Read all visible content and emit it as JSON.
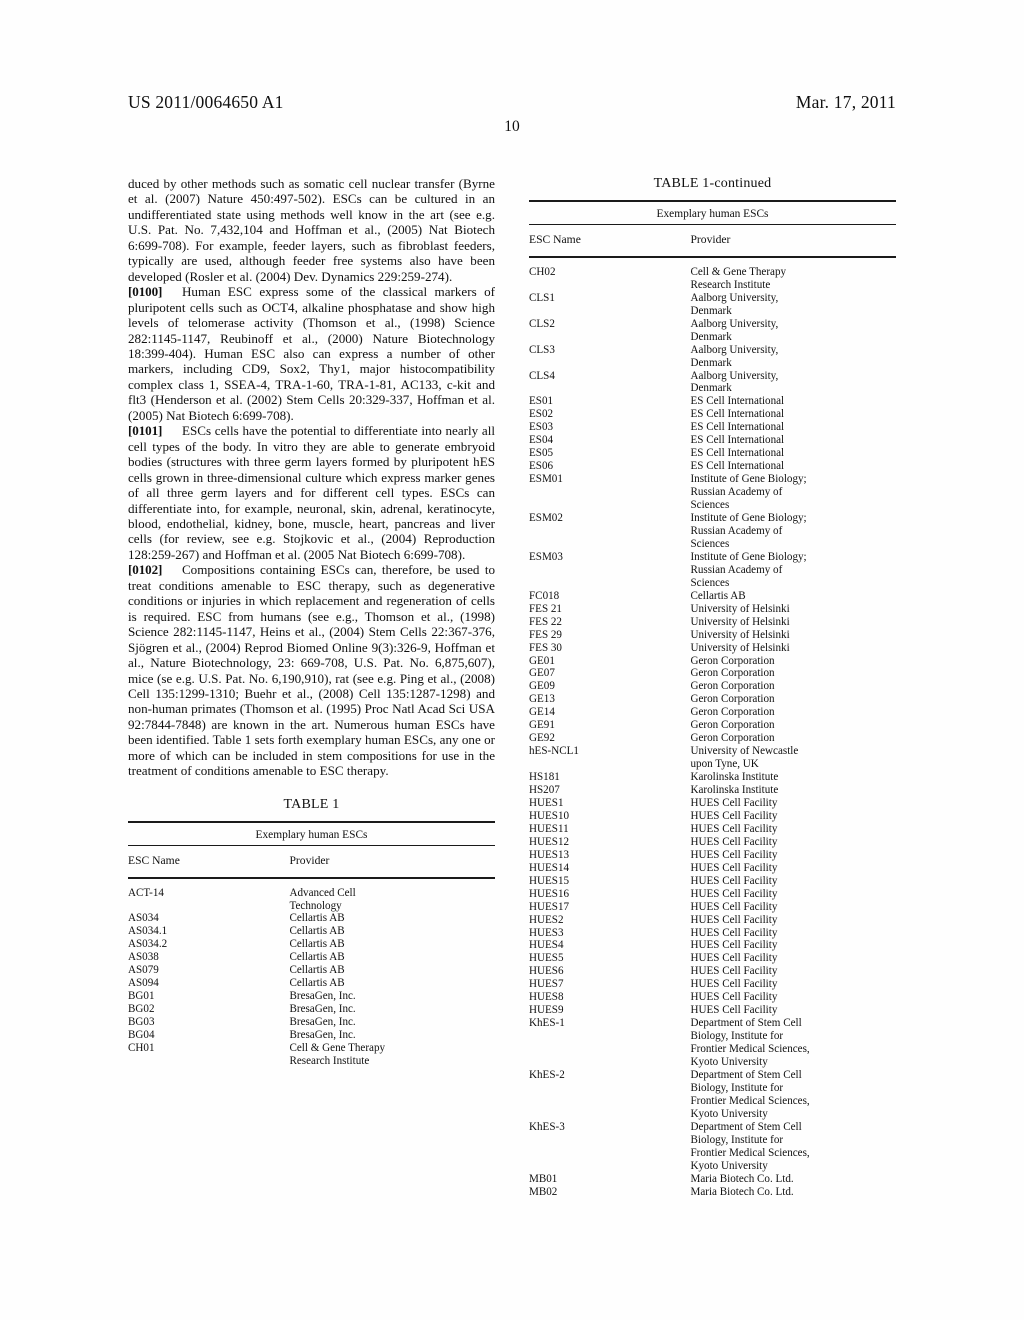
{
  "header": {
    "publication_number": "US 2011/0064650 A1",
    "date": "Mar. 17, 2011",
    "page_number": "10"
  },
  "left_column": {
    "paragraphs": [
      {
        "id": "",
        "text": "duced by other methods such as somatic cell nuclear transfer (Byrne et al. (2007) Nature 450:497-502). ESCs can be cultured in an undifferentiated state using methods well know in the art (see e.g. U.S. Pat. No. 7,432,104 and Hoffman et al., (2005) Nat Biotech 6:699-708). For example, feeder layers, such as fibroblast feeders, typically are used, although feeder free systems also have been developed (Rosler et al. (2004) Dev. Dynamics 229:259-274)."
      },
      {
        "id": "[0100]",
        "text": "Human ESC express some of the classical markers of pluripotent cells such as OCT4, alkaline phosphatase and show high levels of telomerase activity (Thomson et al., (1998) Science 282:1145-1147, Reubinoff et al., (2000) Nature Biotechnology 18:399-404). Human ESC also can express a number of other markers, including CD9, Sox2, Thy1, major histocompatibility complex class 1, SSEA-4, TRA-1-60, TRA-1-81, AC133, c-kit and flt3 (Henderson et al. (2002) Stem Cells 20:329-337, Hoffman et al. (2005) Nat Biotech 6:699-708)."
      },
      {
        "id": "[0101]",
        "text": "ESCs cells have the potential to differentiate into nearly all cell types of the body. In vitro they are able to generate embryoid bodies (structures with three germ layers formed by pluripotent hES cells grown in three-dimensional culture which express marker genes of all three germ layers and for different cell types. ESCs can differentiate into, for example, neuronal, skin, adrenal, keratinocyte, blood, endothelial, kidney, bone, muscle, heart, pancreas and liver cells (for review, see e.g. Stojkovic et al., (2004) Reproduction 128:259-267) and Hoffman et al. (2005 Nat Biotech 6:699-708)."
      },
      {
        "id": "[0102]",
        "text": "Compositions containing ESCs can, therefore, be used to treat conditions amenable to ESC therapy, such as degenerative conditions or injuries in which replacement and regeneration of cells is required. ESC from humans (see e.g., Thomson et al., (1998) Science 282:1145-1147, Heins et al., (2004) Stem Cells 22:367-376, Sjögren et al., (2004) Reprod Biomed Online 9(3):326-9, Hoffman et al., Nature Biotechnology, 23: 669-708, U.S. Pat. No. 6,875,607), mice (se e.g. U.S. Pat. No. 6,190,910), rat (see e.g. Ping et al., (2008) Cell 135:1299-1310; Buehr et al., (2008) Cell 135:1287-1298) and non-human primates (Thomson et al. (1995) Proc Natl Acad Sci USA 92:7844-7848) are known in the art. Numerous human ESCs have been identified. Table 1 sets forth exemplary human ESCs, any one or more of which can be included in stem compositions for use in the treatment of conditions amenable to ESC therapy."
      }
    ],
    "table": {
      "caption": "TABLE 1",
      "span_header": "Exemplary human ESCs",
      "columns": [
        "ESC Name",
        "Provider"
      ],
      "rows": [
        [
          "ACT-14",
          "Advanced Cell\nTechnology"
        ],
        [
          "AS034",
          "Cellartis AB"
        ],
        [
          "AS034.1",
          "Cellartis AB"
        ],
        [
          "AS034.2",
          "Cellartis AB"
        ],
        [
          "AS038",
          "Cellartis AB"
        ],
        [
          "AS079",
          "Cellartis AB"
        ],
        [
          "AS094",
          "Cellartis AB"
        ],
        [
          "BG01",
          "BresaGen, Inc."
        ],
        [
          "BG02",
          "BresaGen, Inc."
        ],
        [
          "BG03",
          "BresaGen, Inc."
        ],
        [
          "BG04",
          "BresaGen, Inc."
        ],
        [
          "CH01",
          "Cell & Gene Therapy\nResearch Institute"
        ]
      ]
    }
  },
  "right_column": {
    "table": {
      "caption": "TABLE 1-continued",
      "span_header": "Exemplary human ESCs",
      "columns": [
        "ESC Name",
        "Provider"
      ],
      "rows": [
        [
          "CH02",
          "Cell & Gene Therapy\nResearch Institute"
        ],
        [
          "CLS1",
          "Aalborg University,\nDenmark"
        ],
        [
          "CLS2",
          "Aalborg University,\nDenmark"
        ],
        [
          "CLS3",
          "Aalborg University,\nDenmark"
        ],
        [
          "CLS4",
          "Aalborg University,\nDenmark"
        ],
        [
          "ES01",
          "ES Cell International"
        ],
        [
          "ES02",
          "ES Cell International"
        ],
        [
          "ES03",
          "ES Cell International"
        ],
        [
          "ES04",
          "ES Cell International"
        ],
        [
          "ES05",
          "ES Cell International"
        ],
        [
          "ES06",
          "ES Cell International"
        ],
        [
          "ESM01",
          "Institute of Gene Biology;\nRussian Academy of\nSciences"
        ],
        [
          "ESM02",
          "Institute of Gene Biology;\nRussian Academy of\nSciences"
        ],
        [
          "ESM03",
          "Institute of Gene Biology;\nRussian Academy of\nSciences"
        ],
        [
          "FC018",
          "Cellartis AB"
        ],
        [
          "FES 21",
          "University of Helsinki"
        ],
        [
          "FES 22",
          "University of Helsinki"
        ],
        [
          "FES 29",
          "University of Helsinki"
        ],
        [
          "FES 30",
          "University of Helsinki"
        ],
        [
          "GE01",
          "Geron Corporation"
        ],
        [
          "GE07",
          "Geron Corporation"
        ],
        [
          "GE09",
          "Geron Corporation"
        ],
        [
          "GE13",
          "Geron Corporation"
        ],
        [
          "GE14",
          "Geron Corporation"
        ],
        [
          "GE91",
          "Geron Corporation"
        ],
        [
          "GE92",
          "Geron Corporation"
        ],
        [
          "hES-NCL1",
          "University of Newcastle\nupon Tyne, UK"
        ],
        [
          "HS181",
          "Karolinska Institute"
        ],
        [
          "HS207",
          "Karolinska Institute"
        ],
        [
          "HUES1",
          "HUES Cell Facility"
        ],
        [
          "HUES10",
          "HUES Cell Facility"
        ],
        [
          "HUES11",
          "HUES Cell Facility"
        ],
        [
          "HUES12",
          "HUES Cell Facility"
        ],
        [
          "HUES13",
          "HUES Cell Facility"
        ],
        [
          "HUES14",
          "HUES Cell Facility"
        ],
        [
          "HUES15",
          "HUES Cell Facility"
        ],
        [
          "HUES16",
          "HUES Cell Facility"
        ],
        [
          "HUES17",
          "HUES Cell Facility"
        ],
        [
          "HUES2",
          "HUES Cell Facility"
        ],
        [
          "HUES3",
          "HUES Cell Facility"
        ],
        [
          "HUES4",
          "HUES Cell Facility"
        ],
        [
          "HUES5",
          "HUES Cell Facility"
        ],
        [
          "HUES6",
          "HUES Cell Facility"
        ],
        [
          "HUES7",
          "HUES Cell Facility"
        ],
        [
          "HUES8",
          "HUES Cell Facility"
        ],
        [
          "HUES9",
          "HUES Cell Facility"
        ],
        [
          "KhES-1",
          "Department of Stem Cell\nBiology, Institute for\nFrontier Medical Sciences,\nKyoto University"
        ],
        [
          "KhES-2",
          "Department of Stem Cell\nBiology, Institute for\nFrontier Medical Sciences,\nKyoto University"
        ],
        [
          "KhES-3",
          "Department of Stem Cell\nBiology, Institute for\nFrontier Medical Sciences,\nKyoto University"
        ],
        [
          "MB01",
          "Maria Biotech Co. Ltd."
        ],
        [
          "MB02",
          "Maria Biotech Co. Ltd."
        ]
      ]
    }
  }
}
